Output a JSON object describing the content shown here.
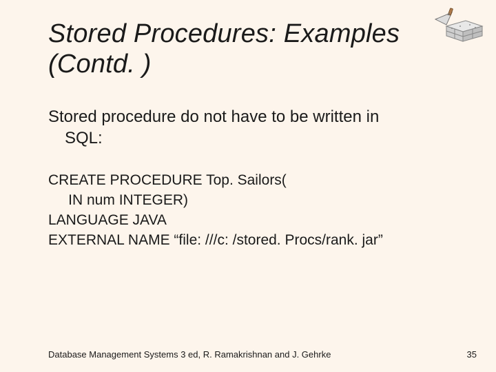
{
  "title": "Stored Procedures: Examples (Contd. )",
  "body_line1": "Stored procedure do not have to be written in",
  "body_line2": "SQL:",
  "code_line1": "CREATE PROCEDURE Top. Sailors(",
  "code_line2": "     IN num INTEGER)",
  "code_line3": "LANGUAGE JAVA",
  "code_line4": "EXTERNAL NAME “file: ///c: /stored. Procs/rank. jar”",
  "footer_left": "Database Management Systems 3 ed,  R. Ramakrishnan and J. Gehrke",
  "footer_right": "35"
}
